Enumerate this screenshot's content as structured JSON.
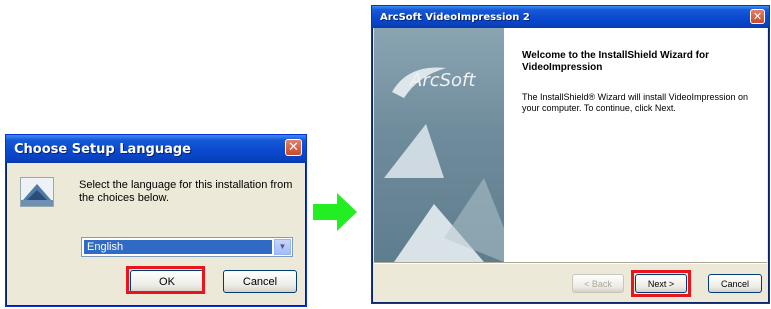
{
  "dialog1": {
    "title": "Choose Setup Language",
    "message": "Select the language for this installation from the choices below.",
    "language_select": {
      "selected": "English"
    },
    "ok_label": "OK",
    "cancel_label": "Cancel",
    "close_glyph": "✕"
  },
  "dialog2": {
    "title": "ArcSoft VideoImpression 2",
    "logo": "ArcSoft",
    "welcome_heading": "Welcome to the InstallShield Wizard for VideoImpression",
    "body": "The InstallShield® Wizard will install VideoImpression on your computer. To continue, click Next.",
    "back_label": "< Back",
    "next_label": "Next >",
    "cancel_label": "Cancel",
    "close_glyph": "✕"
  },
  "colors": {
    "highlight": "#e8161c",
    "arrow": "#22ee22",
    "titlebar": "#0a49d0"
  }
}
